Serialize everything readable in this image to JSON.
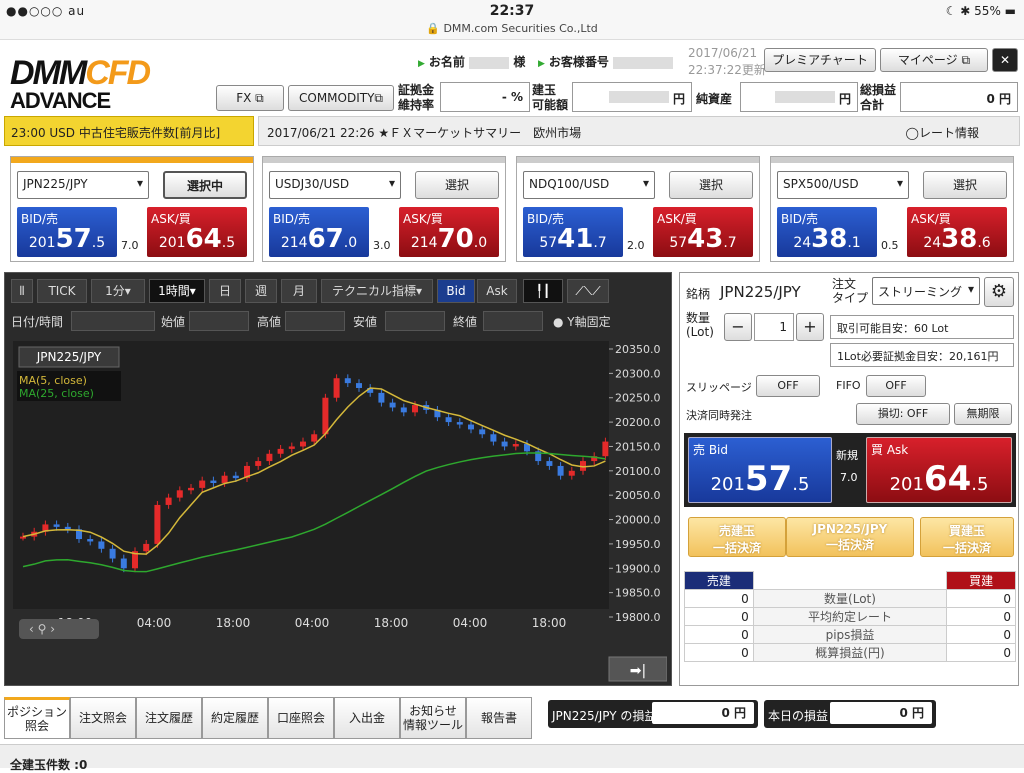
{
  "status": {
    "carrier": "●●○○○ au",
    "time": "22:37",
    "site": "DMM.com Securities Co.,Ltd",
    "battery": "55%"
  },
  "logo": {
    "top_a": "DMM",
    "top_b": "CFD",
    "bottom": "ADVANCE"
  },
  "header": {
    "name_label": "お名前",
    "name_suffix": "様",
    "cust_label": "お客様番号",
    "date": "2017/06/21",
    "datetime": "22:37:22更新",
    "premier": "プレミアチャート",
    "mypage": "マイページ",
    "fx": "FX",
    "commodity": "COMMODITY"
  },
  "account": {
    "margin_label": "証拠金\n維持率",
    "margin_val": "- %",
    "build_label": "建玉\n可能額",
    "build_unit": "円",
    "net_label": "純資産",
    "net_unit": "円",
    "total_label": "総損益\n合計",
    "total_val": "0 円"
  },
  "ticker": {
    "text": "23:00  USD  中古住宅販売件数[前月比]",
    "news": "2017/06/21 22:26 ★ＦＸマーケットサマリー　欧州市場",
    "rate_info": "レート情報"
  },
  "panels": [
    {
      "symbol": "JPN225/JPY",
      "select": "選択中",
      "bid_lbl": "BID/売",
      "ask_lbl": "ASK/買",
      "bid_s": "201",
      "bid_b": "57",
      "bid_d": ".5",
      "ask_s": "201",
      "ask_b": "64",
      "ask_d": ".5",
      "spread": "7.0"
    },
    {
      "symbol": "USDJ30/USD",
      "select": "選択",
      "bid_lbl": "BID/売",
      "ask_lbl": "ASK/買",
      "bid_s": "214",
      "bid_b": "67",
      "bid_d": ".0",
      "ask_s": "214",
      "ask_b": "70",
      "ask_d": ".0",
      "spread": "3.0"
    },
    {
      "symbol": "NDQ100/USD",
      "select": "選択",
      "bid_lbl": "BID/売",
      "ask_lbl": "ASK/買",
      "bid_s": "57",
      "bid_b": "41",
      "bid_d": ".7",
      "ask_s": "57",
      "ask_b": "43",
      "ask_d": ".7",
      "spread": "2.0"
    },
    {
      "symbol": "SPX500/USD",
      "select": "選択",
      "bid_lbl": "BID/売",
      "ask_lbl": "ASK/買",
      "bid_s": "24",
      "bid_b": "38",
      "bid_d": ".1",
      "ask_s": "24",
      "ask_b": "38",
      "ask_d": ".6",
      "spread": "0.5"
    }
  ],
  "chart_toolbar": {
    "tick": "TICK",
    "m1": "1分",
    "h1": "1時間",
    "day": "日",
    "week": "週",
    "month": "月",
    "tech": "テクニカル指標",
    "bid": "Bid",
    "ask": "Ask"
  },
  "chart_fields": {
    "datetime": "日付/時間",
    "open": "始値",
    "high": "高値",
    "low": "安値",
    "close": "終値",
    "yfix": "Y軸固定"
  },
  "chart_data": {
    "type": "line",
    "title": "JPN225/JPY",
    "series": [
      {
        "name": "MA(5, close)",
        "color": "#d4b83a"
      },
      {
        "name": "MA(25, close)",
        "color": "#2ea82e"
      }
    ],
    "y_ticks": [
      "20350.0",
      "20300.0",
      "20250.0",
      "20200.0",
      "20150.0",
      "20100.0",
      "20050.0",
      "20000.0",
      "19950.0",
      "19900.0",
      "19850.0",
      "19800.0"
    ],
    "x_ticks": [
      "18:00",
      "04:00",
      "18:00",
      "04:00",
      "18:00",
      "04:00",
      "18:00"
    ],
    "ylim": [
      19800,
      20350
    ]
  },
  "order": {
    "symbol_label": "銘柄",
    "symbol": "JPN225/JPY",
    "type_label": "注文\nタイプ",
    "type": "ストリーミング",
    "qty_label": "数量\n(Lot)",
    "qty": "1",
    "tradable": "取引可能目安：60 Lot",
    "margin_need": "1Lot必要証拠金目安：20,161円",
    "slip_label": "スリッページ",
    "slip": "OFF",
    "fifo_label": "FIFO",
    "fifo": "OFF",
    "settle_label": "決済同時発注",
    "stop": "損切: OFF",
    "period": "無期限",
    "sell_lbl": "売 Bid",
    "buy_lbl": "買 Ask",
    "new_lbl": "新規",
    "spread": "7.0",
    "sell_s": "201",
    "sell_b": "57",
    "sell_d": ".5",
    "buy_s": "201",
    "buy_b": "64",
    "buy_d": ".5"
  },
  "bulk": {
    "sell": "売建玉\n一括決済",
    "mid": "JPN225/JPY\n一括決済",
    "buy": "買建玉\n一括決済"
  },
  "positions": {
    "sell_h": "売建",
    "buy_h": "買建",
    "rows": [
      [
        "0",
        "数量(Lot)",
        "0"
      ],
      [
        "0",
        "平均約定レート",
        "0"
      ],
      [
        "0",
        "pips損益",
        "0"
      ],
      [
        "0",
        "概算損益(円)",
        "0"
      ]
    ]
  },
  "tabs": [
    "ポジション\n照会",
    "注文照会",
    "注文履歴",
    "約定履歴",
    "口座照会",
    "入出金",
    "お知らせ\n情報ツール",
    "報告書"
  ],
  "pnl": {
    "sym_label": "JPN225/JPY の損益",
    "sym_val": "0  円",
    "today_label": "本日の損益",
    "today_val": "0  円"
  },
  "footer": {
    "count": "全建玉件数 :0"
  }
}
